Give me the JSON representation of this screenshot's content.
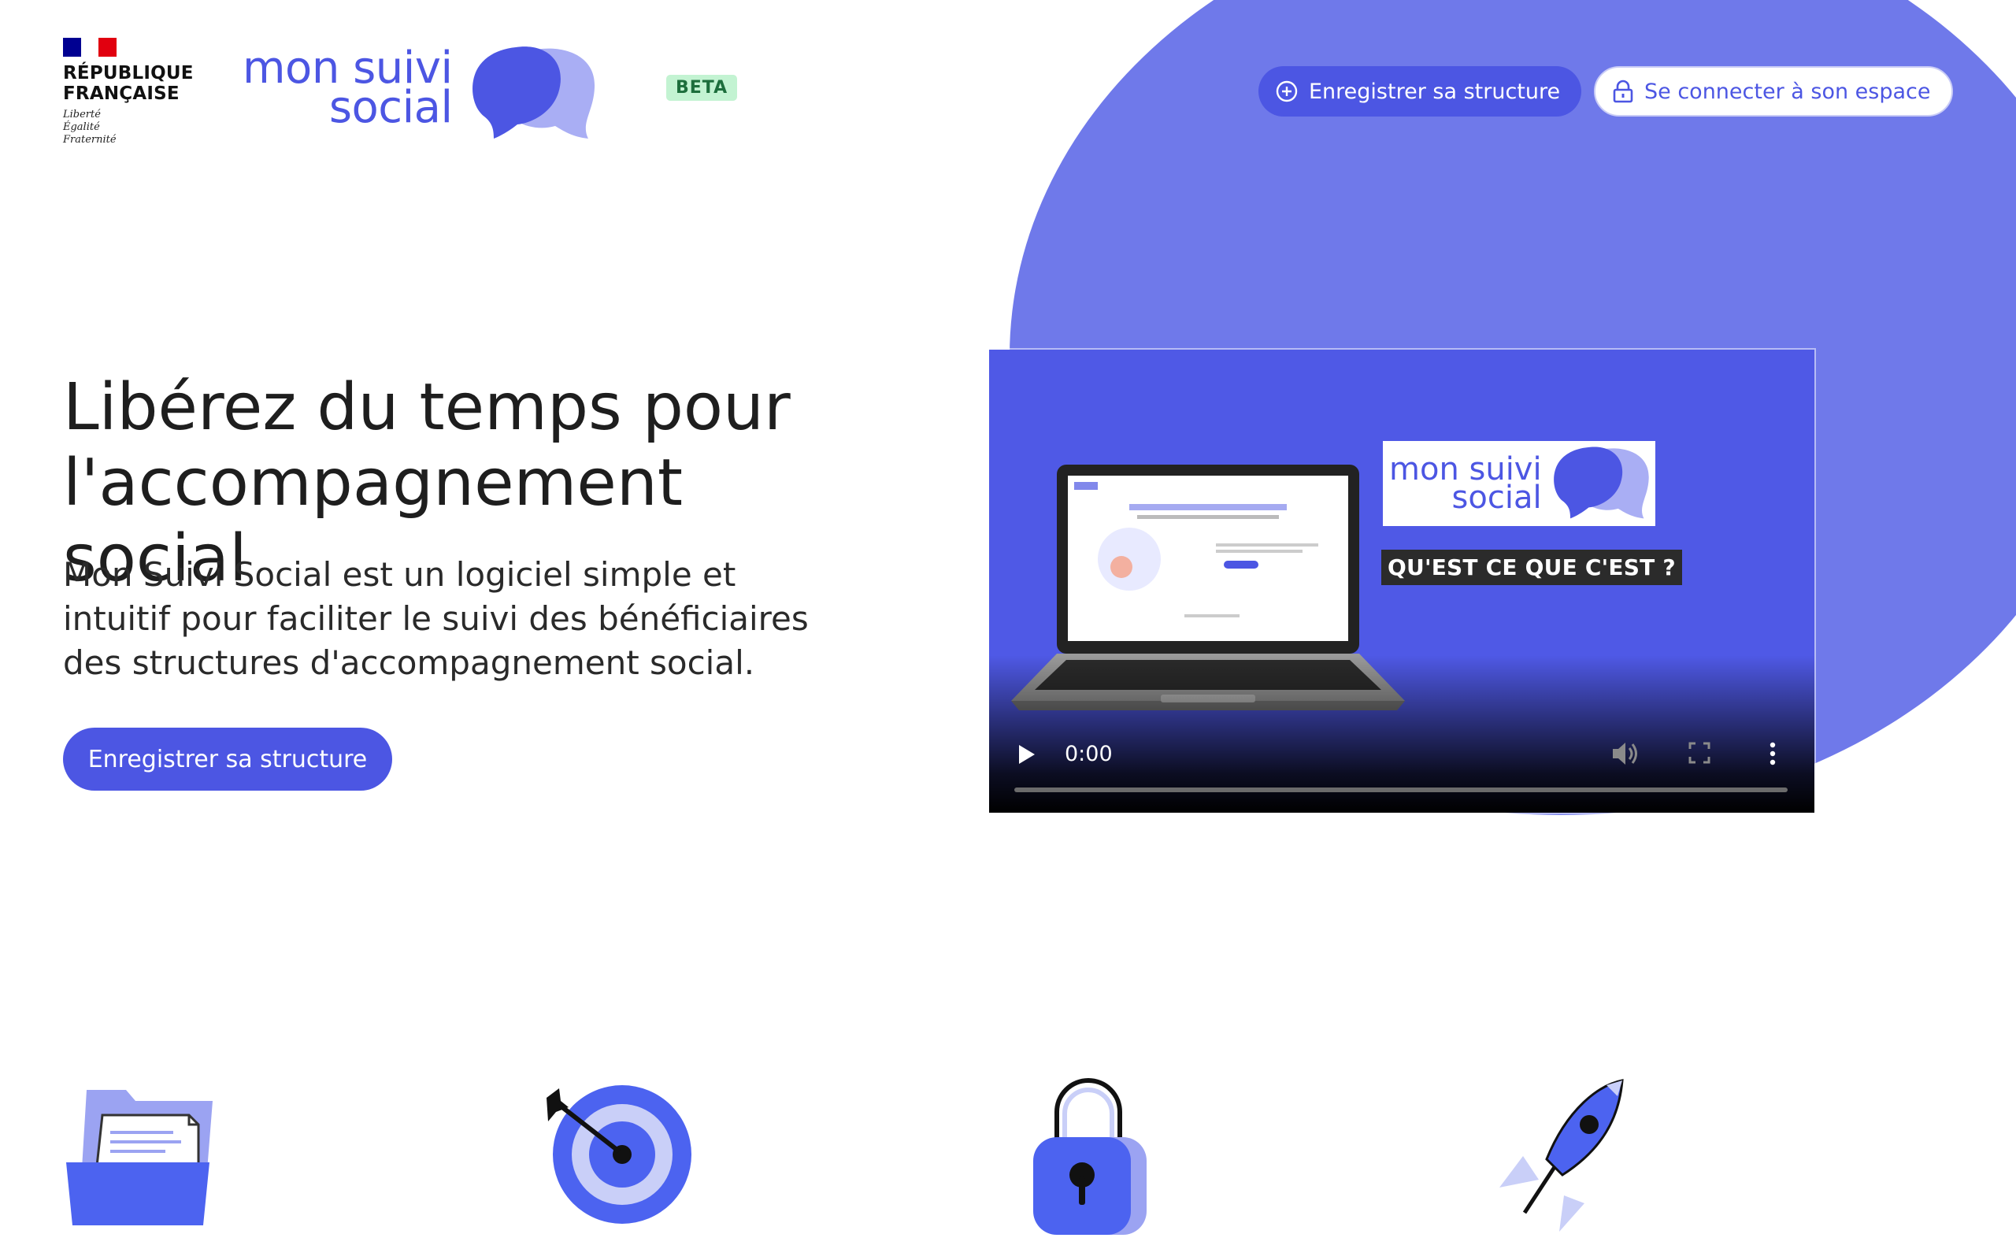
{
  "header": {
    "gov": {
      "name_line1": "RÉPUBLIQUE",
      "name_line2": "FRANÇAISE",
      "motto_1": "Liberté",
      "motto_2": "Égalité",
      "motto_3": "Fraternité"
    },
    "brand_line1": "mon suivi",
    "brand_line2": "social",
    "beta_label": "BETA",
    "register_button": "Enregistrer sa structure",
    "login_button": "Se connecter à son espace"
  },
  "hero": {
    "title_line1": "Libérez du temps pour",
    "title_line2": "l'accompagnement social",
    "desc_line1": "Mon Suivi Social est un logiciel simple et",
    "desc_line2": "intuitif pour faciliter le suivi des bénéficiaires",
    "desc_line3": "des structures d'accompagnement social.",
    "cta_label": "Enregistrer sa structure"
  },
  "video": {
    "brand_line1": "mon suivi",
    "brand_line2": "social",
    "caption": "QU'EST CE QUE C'EST ?",
    "current_time": "0:00",
    "progress": 0
  },
  "features": {
    "icons": [
      "folder-icon",
      "target-icon",
      "padlock-icon",
      "rocket-icon"
    ]
  },
  "colors": {
    "brand": "#4c56e3",
    "blob": "#6f79ea",
    "beta_bg": "#c3f3d2",
    "flag_blue": "#000091",
    "flag_red": "#e1000f"
  }
}
